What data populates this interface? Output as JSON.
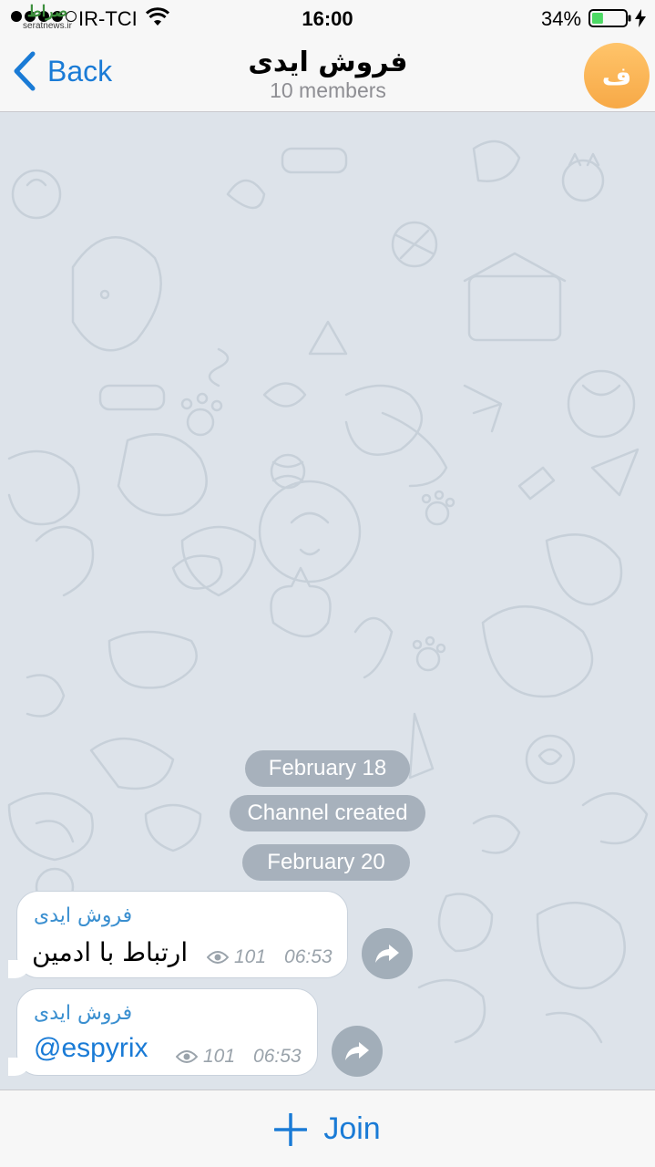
{
  "status_bar": {
    "carrier": "IR-TCI",
    "time": "16:00",
    "battery_percent": "34%",
    "battery_level": 0.34,
    "signal_bars_filled": 4,
    "watermark_logo": "صراط",
    "watermark_url": "seratnews.ir"
  },
  "nav": {
    "back_label": "Back",
    "title": "فروش ایدی",
    "subtitle": "10 members",
    "avatar_letter": "ف",
    "avatar_color": "#f7a947"
  },
  "chat": {
    "service_messages": [
      {
        "text": "February 18"
      },
      {
        "text": "Channel created"
      },
      {
        "text": "February 20"
      }
    ],
    "messages": [
      {
        "author": "فروش ایدی",
        "text": "ارتباط با ادمین",
        "views": "101",
        "time": "06:53"
      },
      {
        "author": "فروش ایدی",
        "text": "@espyrix",
        "views": "101",
        "time": "06:53"
      }
    ]
  },
  "bottom": {
    "join_label": "Join"
  },
  "colors": {
    "accent": "#1a7bd6",
    "author": "#3a8fd0",
    "wallpaper": "#dde3ea"
  },
  "icons": [
    "wifi-icon",
    "battery-icon",
    "charge-icon",
    "back-chevron-icon",
    "eye-icon",
    "share-icon",
    "plus-icon"
  ]
}
